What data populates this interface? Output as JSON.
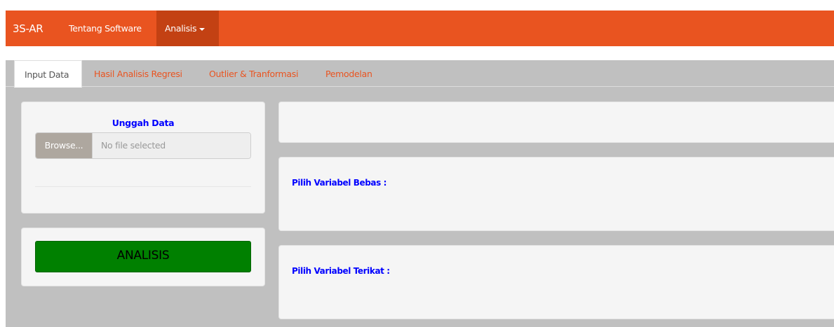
{
  "navbar": {
    "brand": "3S-AR",
    "items": [
      {
        "label": "Tentang Software"
      },
      {
        "label": "Analisis"
      }
    ]
  },
  "tabs": [
    {
      "label": "Input Data",
      "active": true
    },
    {
      "label": "Hasil Analisis Regresi",
      "active": false
    },
    {
      "label": "Outlier & Tranformasi",
      "active": false
    },
    {
      "label": "Pemodelan",
      "active": false
    }
  ],
  "upload": {
    "title": "Unggah Data",
    "browse_label": "Browse...",
    "file_placeholder": "No file selected"
  },
  "analyze": {
    "button_label": "ANALISIS"
  },
  "variables": {
    "bebas_label": "Pilih Variabel Bebas :",
    "terikat_label": "Pilih Variabel Terikat :"
  },
  "colors": {
    "navbar": "#e95420",
    "navbar_active": "#c34113",
    "tab_link": "#e95420",
    "content_bg": "#c0c0c0",
    "panel_bg": "#f5f5f5",
    "label_blue": "#0000ff",
    "analyze_green": "#008000",
    "browse_btn": "#aea79f"
  }
}
